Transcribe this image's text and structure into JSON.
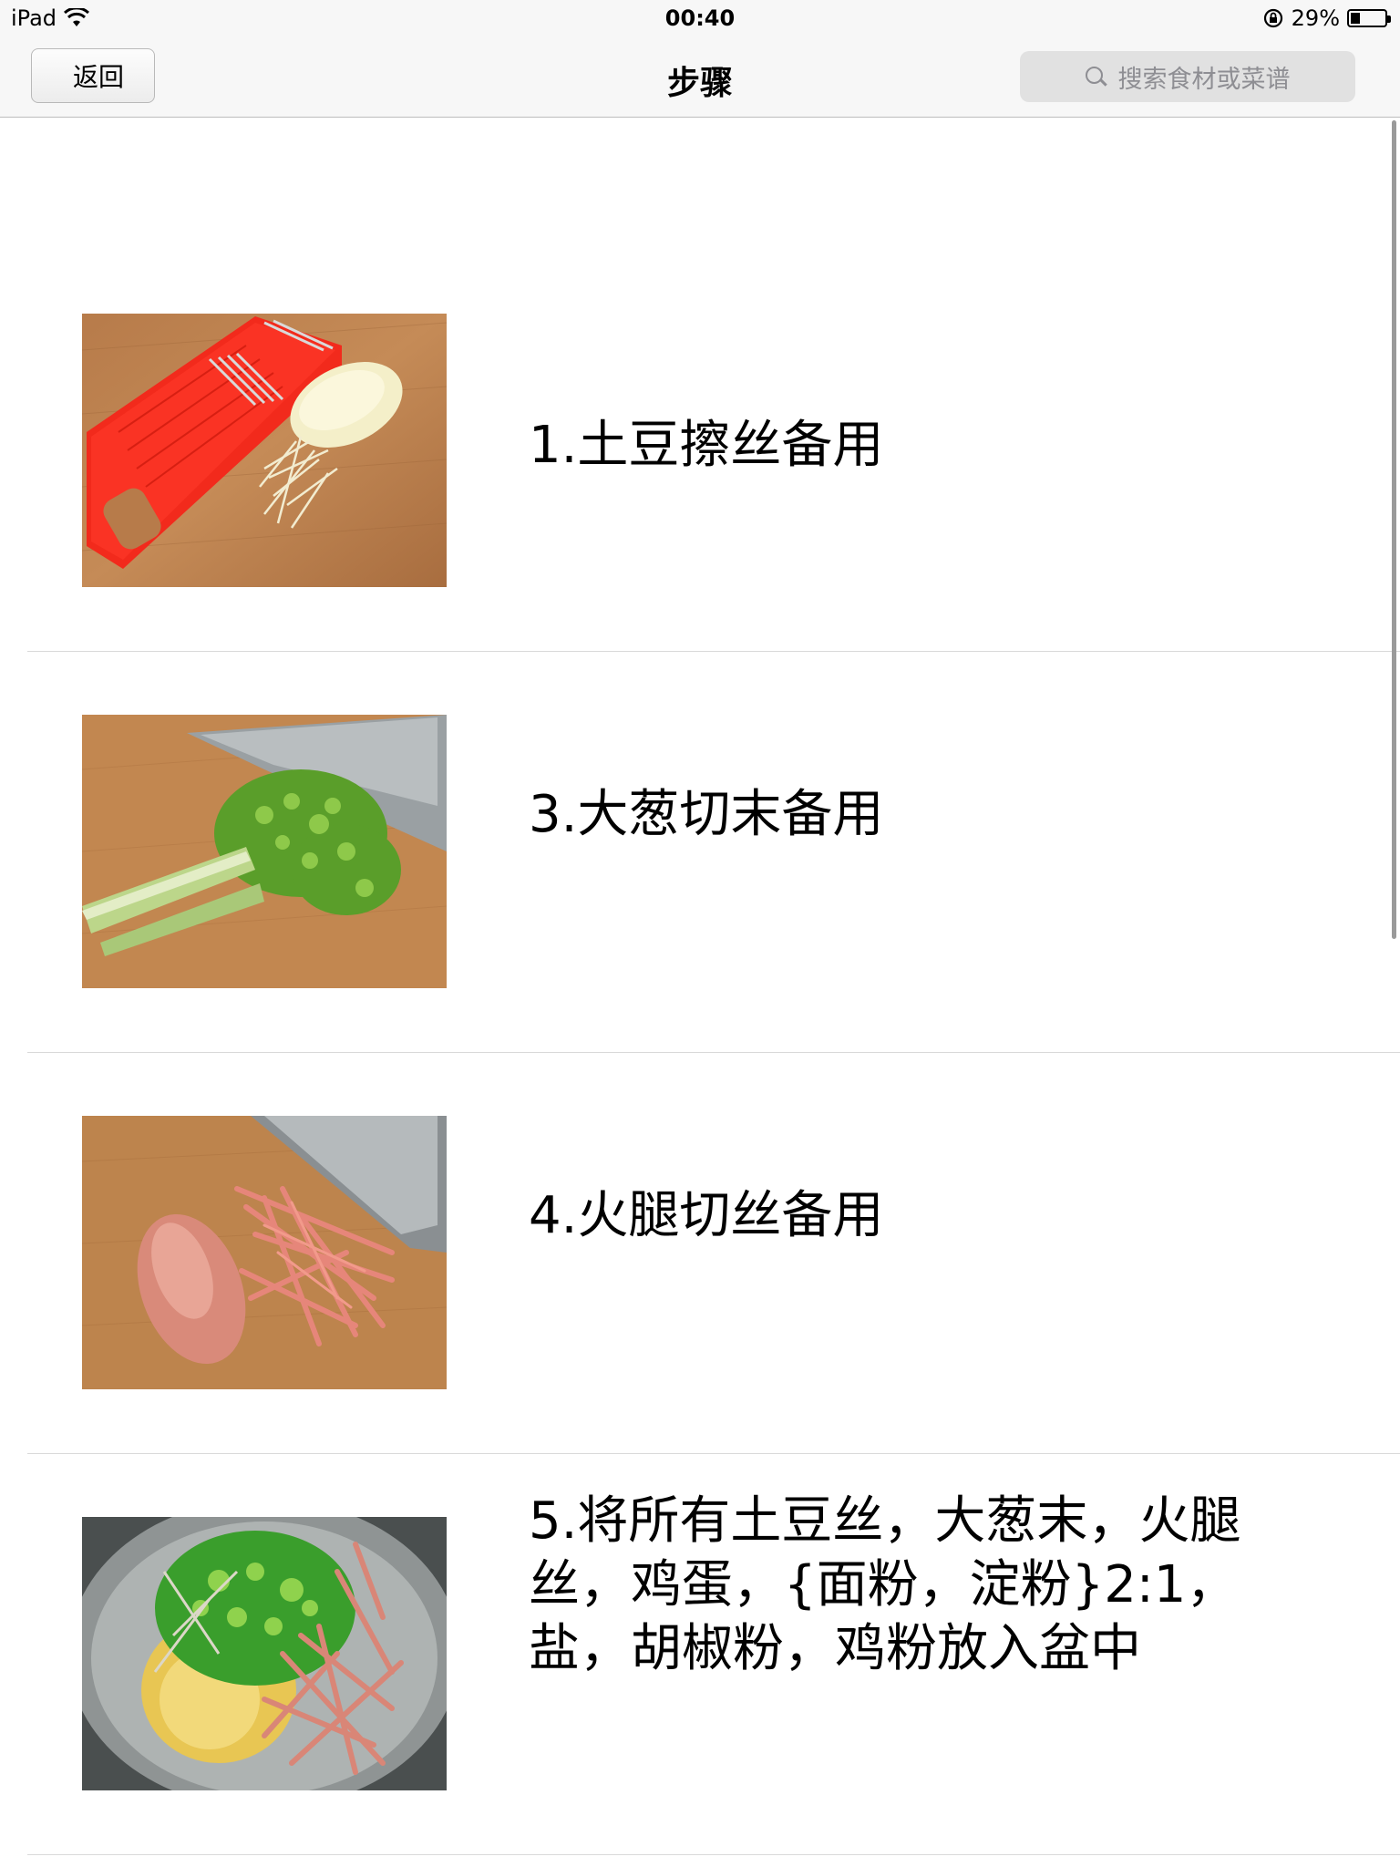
{
  "status_bar": {
    "device": "iPad",
    "time": "00:40",
    "battery": "29%",
    "battery_level": 0.29
  },
  "nav": {
    "back_label": "返回",
    "title": "步骤",
    "search_placeholder": "搜索食材或菜谱"
  },
  "steps": [
    {
      "text": "1.土豆擦丝备用",
      "image": "grater-potato-photo"
    },
    {
      "text": "3.大葱切末备用",
      "image": "scallion-knife-photo"
    },
    {
      "text": "4.火腿切丝备用",
      "image": "ham-strips-photo"
    },
    {
      "text": "5.将所有土豆丝，大葱末，火腿丝，鸡蛋，{面粉，淀粉}2:1，盐，胡椒粉，鸡粉放入盆中",
      "image": "mixing-bowl-photo"
    }
  ],
  "icons": [
    "wifi-icon",
    "rotation-lock-icon",
    "battery-icon",
    "back-chevron-icon",
    "search-icon"
  ]
}
